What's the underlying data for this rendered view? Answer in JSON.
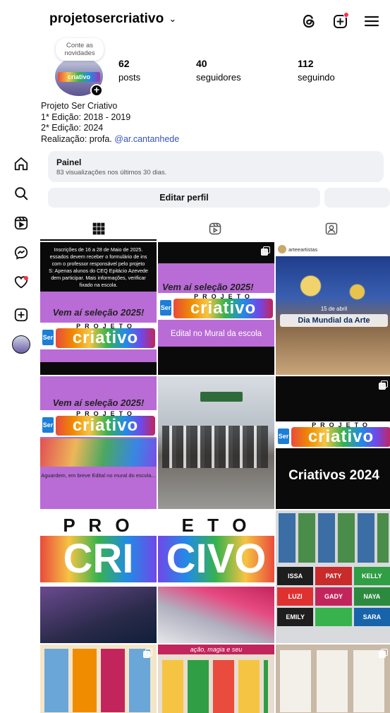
{
  "header": {
    "username": "projetosercriativo",
    "username_chevron": "⌄"
  },
  "profile": {
    "note": "Conte as novidades",
    "avatar_logo": "criativo",
    "stats": [
      {
        "value": "62",
        "label": "posts"
      },
      {
        "value": "40",
        "label": "seguidores"
      },
      {
        "value": "112",
        "label": "seguindo"
      }
    ],
    "bio": {
      "line1": "Projeto Ser Criativo",
      "line2": "1* Edição: 2018 - 2019",
      "line3": "2* Edição: 2024",
      "line4_prefix": "Realização: profa.",
      "line4_link": "@ar.cantanhede"
    }
  },
  "painel": {
    "title": "Painel",
    "subtitle": "83 visualizações nos últimos 30 dias."
  },
  "buttons": {
    "edit_profile": "Editar perfil"
  },
  "colors": {
    "accent_link": "#3753b8",
    "notification_dot": "#ff3040",
    "button_bg": "#eff1f4",
    "purple_panel": "#b96bd6"
  },
  "posts": {
    "p1": {
      "lines": [
        "Inscrições de 16 a 28 de Maio de 2025.",
        "essados devem receber o formulário de ins",
        "com o professor responsável pelo projeto",
        "S: Apenas alunos do CEQ Epitácio Azevede",
        "dem participar. Mais informações,  verificar",
        "fixado na escola."
      ],
      "headline": "Vem aí seleção 2025!",
      "logo_top": "PROJETO",
      "logo_word": "criativo",
      "logo_ser": "Ser"
    },
    "p2": {
      "headline": "Vem aí seleção 2025!",
      "logo_top": "PROJETO",
      "logo_word": "criativo",
      "logo_ser": "Ser",
      "caption": "Edital no Mural da escola"
    },
    "p3": {
      "account": "arteeartistas",
      "date": "15 de abril",
      "title": "Dia Mundial da Arte"
    },
    "p4": {
      "headline": "Vem aí seleção 2025!",
      "logo_top": "PROJETO",
      "logo_word": "criativo",
      "logo_ser": "Ser",
      "caption": "Aguardem, em breve Edital no mural do escola..."
    },
    "p6": {
      "logo_top": "PROJETO",
      "logo_word": "criativo",
      "logo_ser": "Ser",
      "caption": "Criativos 2024"
    },
    "p7": {
      "top": "P R O",
      "word": "CRI"
    },
    "p8": {
      "top": "E T O",
      "word": "CIVO"
    },
    "p9": {
      "names": [
        "ISSA",
        "PATY",
        "KELLY",
        "LUZI",
        "GADY",
        "NAYA",
        "EMILY",
        "",
        "SARA"
      ]
    },
    "p11": {
      "banner": "ação, magia e seu"
    }
  }
}
